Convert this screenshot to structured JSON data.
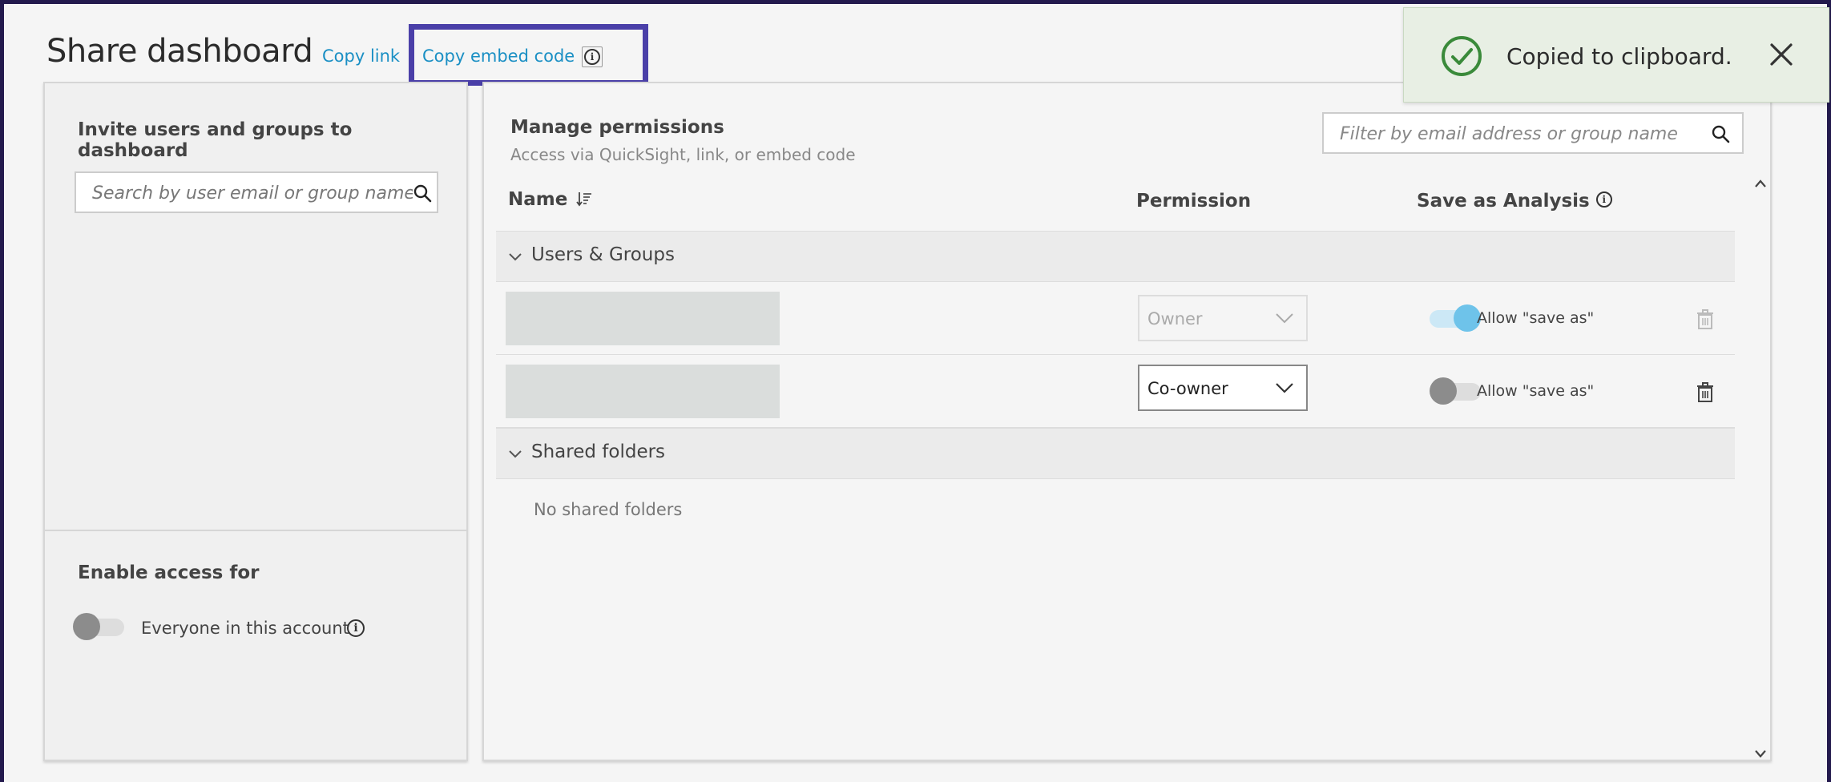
{
  "header": {
    "title": "Share dashboard",
    "copy_link": "Copy link",
    "copy_embed_code": "Copy embed code"
  },
  "invite": {
    "title": "Invite users and groups to dashboard",
    "search_placeholder": "Search by user email or group name"
  },
  "access": {
    "title": "Enable access for",
    "everyone_label": "Everyone in this account",
    "everyone_enabled": false
  },
  "manage": {
    "title": "Manage permissions",
    "subtitle": "Access via QuickSight, link, or embed code",
    "filter_placeholder": "Filter by email address or group name",
    "columns": {
      "name": "Name",
      "permission": "Permission",
      "save_as": "Save as Analysis"
    },
    "groups": [
      {
        "label": "Users & Groups"
      },
      {
        "label": "Shared folders"
      }
    ],
    "users": [
      {
        "name": "",
        "permission": "Owner",
        "permission_disabled": true,
        "allow_save_as": true,
        "allow_label": "Allow \"save as\""
      },
      {
        "name": "",
        "permission": "Co-owner",
        "permission_disabled": false,
        "allow_save_as": false,
        "allow_label": "Allow \"save as\""
      }
    ],
    "no_folders": "No shared folders"
  },
  "toast": {
    "message": "Copied to clipboard."
  },
  "colors": {
    "link": "#1a8fc4",
    "highlight_border": "#4a3fa8",
    "toggle_on": "#6ec3ea",
    "toast_check": "#3a8a3a"
  }
}
